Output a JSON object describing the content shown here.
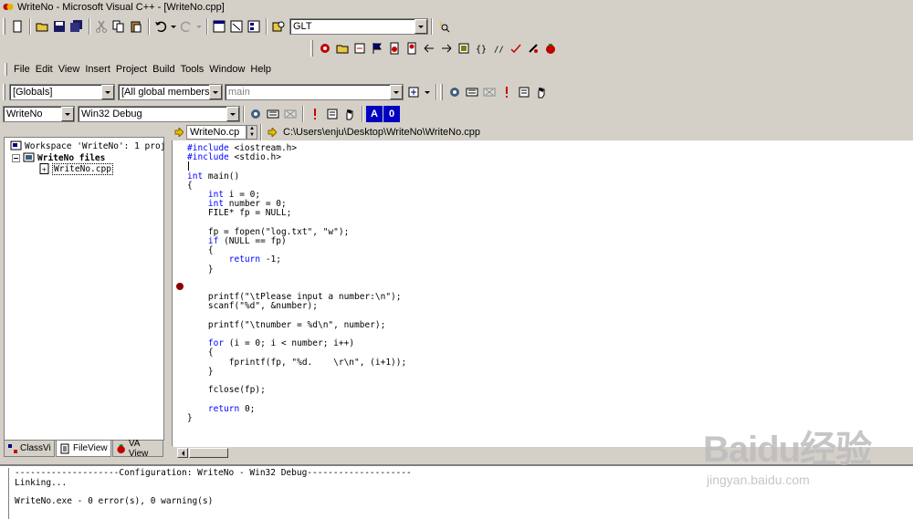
{
  "window": {
    "title": "WriteNo - Microsoft Visual C++ - [WriteNo.cpp]"
  },
  "toolbar_top": {
    "find_combo_value": "GLT"
  },
  "menu": [
    "File",
    "Edit",
    "View",
    "Insert",
    "Project",
    "Build",
    "Tools",
    "Window",
    "Help"
  ],
  "wizardbar": {
    "scope": "[Globals]",
    "members": "[All global members",
    "function": "main"
  },
  "buildbar": {
    "project": "WriteNo",
    "config": "Win32 Debug",
    "btn_a": "A",
    "btn_0": "0"
  },
  "workspace": {
    "root": "Workspace 'WriteNo': 1 proj",
    "files_folder": "WriteNo files",
    "file": "WriteNo.cpp",
    "tabs": [
      "ClassView",
      "FileView",
      "VA View"
    ]
  },
  "editor": {
    "file_tab": "WriteNo.cp",
    "path": "C:\\Users\\enju\\Desktop\\WriteNo\\WriteNo.cpp",
    "lines": [
      "#include <iostream.h>",
      "#include <stdio.h>",
      "",
      "int main()",
      "{",
      "    int i = 0;",
      "    int number = 0;",
      "    FILE* fp = NULL;",
      "",
      "    fp = fopen(\"log.txt\", \"w\");",
      "    if (NULL == fp)",
      "    {",
      "        return -1;",
      "    }",
      "",
      "",
      "    printf(\"\\tPlease input a number:\\n\");",
      "    scanf(\"%d\", &number);",
      "",
      "    printf(\"\\tnumber = %d\\n\", number);",
      "",
      "    for (i = 0; i < number; i++)",
      "    {",
      "        fprintf(fp, \"%d.    \\r\\n\", (i+1));",
      "    }",
      "",
      "    fclose(fp);",
      "",
      "    return 0;",
      "}"
    ]
  },
  "output": {
    "config_line": "--------------------Configuration: WriteNo - Win32 Debug--------------------",
    "linking": "Linking...",
    "result": "WriteNo.exe - 0 error(s), 0 warning(s)"
  },
  "watermark": {
    "brand": "Baidu经验",
    "url": "jingyan.baidu.com"
  },
  "colors": {
    "keyword": "#0000ff",
    "breakpoint": "#8b0000",
    "chrome": "#d4d0c8"
  }
}
